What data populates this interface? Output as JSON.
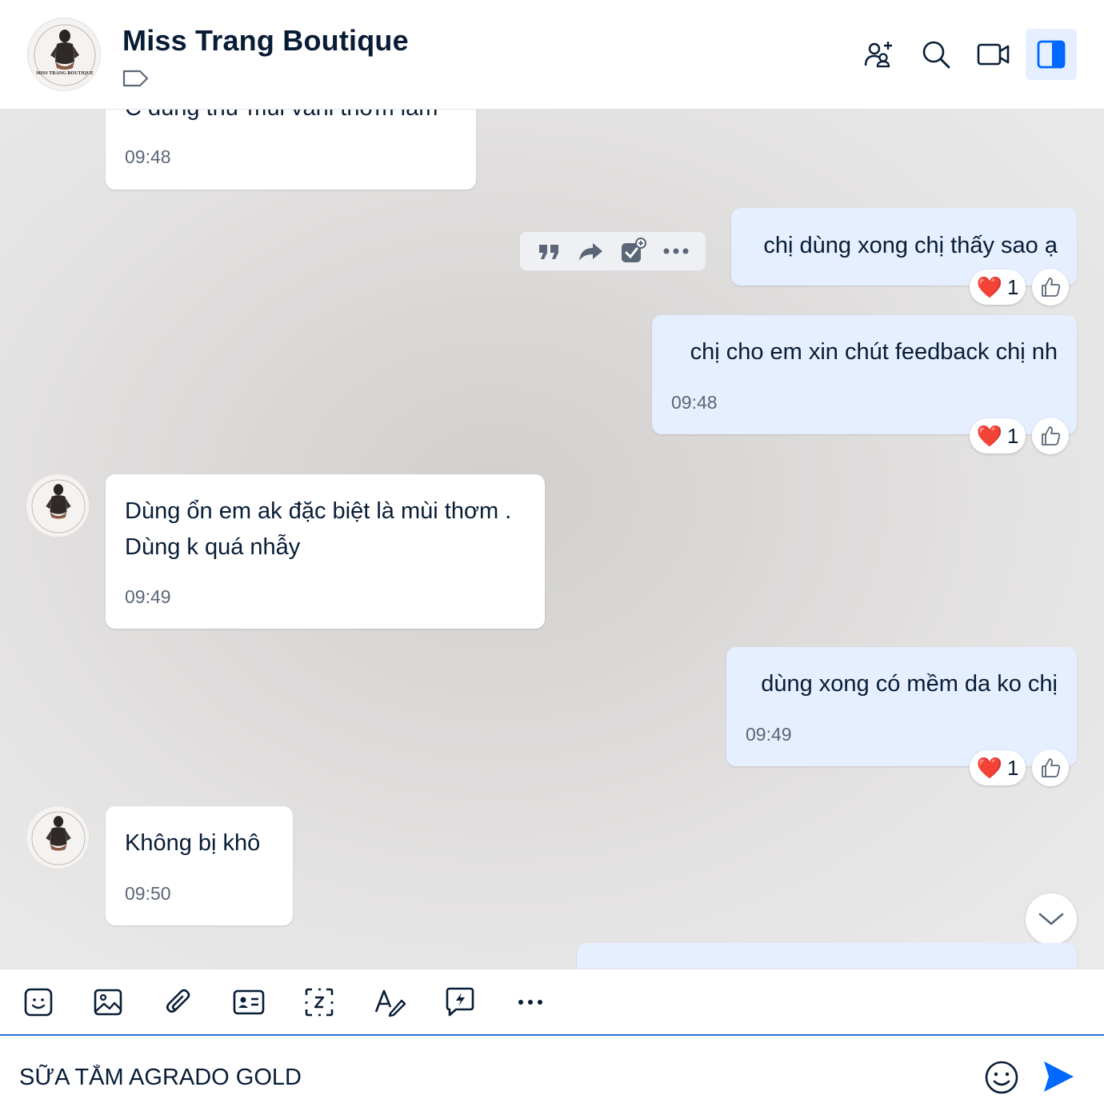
{
  "header": {
    "title": "Miss Trang Boutique",
    "avatar_text": "MISS TRANG BOUTIQUE",
    "buttons": [
      "add-member-icon",
      "search-icon",
      "video-call-icon",
      "sidebar-toggle-icon"
    ]
  },
  "colors": {
    "accent": "#0068ff",
    "outgoing_bubble": "#e5efff",
    "incoming_bubble": "#ffffff",
    "text": "#081c36",
    "heart": "#e53935"
  },
  "messages": [
    {
      "direction": "in",
      "text": "C dùng thử mùi vani thơm lắm",
      "time": "09:48",
      "partial": true
    },
    {
      "direction": "out",
      "text": "chị dùng xong chị thấy sao ạ",
      "reaction": {
        "emoji": "❤️",
        "count": "1"
      }
    },
    {
      "direction": "out",
      "text": "chị cho em xin chút feedback chị nh",
      "time": "09:48",
      "reaction": {
        "emoji": "❤️",
        "count": "1"
      }
    },
    {
      "direction": "in",
      "lines": [
        "Dùng ổn em ak đặc biệt là mùi thơm .",
        "Dùng k quá nhẫy"
      ],
      "time": "09:49"
    },
    {
      "direction": "out",
      "text": "dùng xong có mềm da ko chị",
      "time": "09:49",
      "reaction": {
        "emoji": "❤️",
        "count": "1"
      }
    },
    {
      "direction": "in",
      "text": "Không bị khô",
      "time": "09:50"
    }
  ],
  "message_actions": [
    "quote-icon",
    "forward-icon",
    "add-task-icon",
    "more-icon"
  ],
  "toolbar": [
    "sticker-icon",
    "image-icon",
    "attach-icon",
    "contact-card-icon",
    "screenshot-icon",
    "text-format-icon",
    "quick-message-icon",
    "more-icon"
  ],
  "composer": {
    "value": "SỮA TẮM AGRADO GOLD"
  }
}
